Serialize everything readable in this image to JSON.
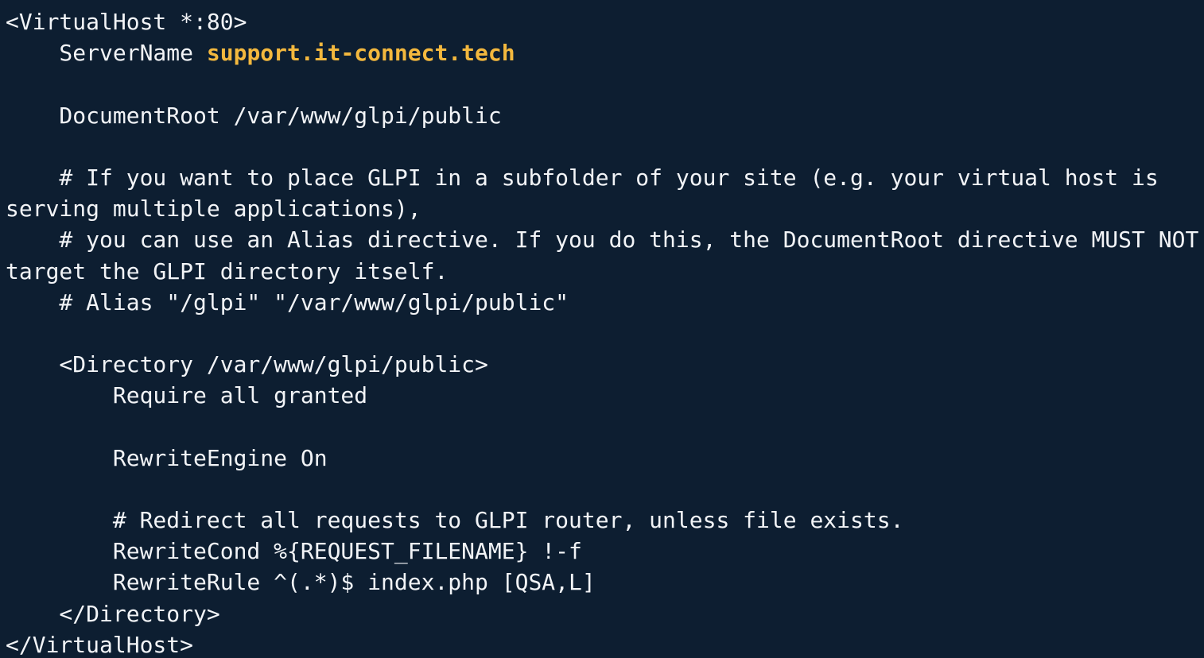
{
  "colors": {
    "background": "#0d1e31",
    "text": "#f2f4f7",
    "highlight": "#f3b83e"
  },
  "config": {
    "line1": "<VirtualHost *:80>",
    "line2_prefix": "    ServerName ",
    "server_name": "support.it-connect.tech",
    "line3": "",
    "line4": "    DocumentRoot /var/www/glpi/public",
    "line5": "",
    "line6": "    # If you want to place GLPI in a subfolder of your site (e.g. your virtual host is",
    "line7": "serving multiple applications),",
    "line8": "    # you can use an Alias directive. If you do this, the DocumentRoot directive MUST NOT",
    "line9": "target the GLPI directory itself.",
    "line10": "    # Alias \"/glpi\" \"/var/www/glpi/public\"",
    "line11": "",
    "line12": "    <Directory /var/www/glpi/public>",
    "line13": "        Require all granted",
    "line14": "",
    "line15": "        RewriteEngine On",
    "line16": "",
    "line17": "        # Redirect all requests to GLPI router, unless file exists.",
    "line18": "        RewriteCond %{REQUEST_FILENAME} !-f",
    "line19": "        RewriteRule ^(.*)$ index.php [QSA,L]",
    "line20": "    </Directory>",
    "line21": "</VirtualHost>"
  }
}
